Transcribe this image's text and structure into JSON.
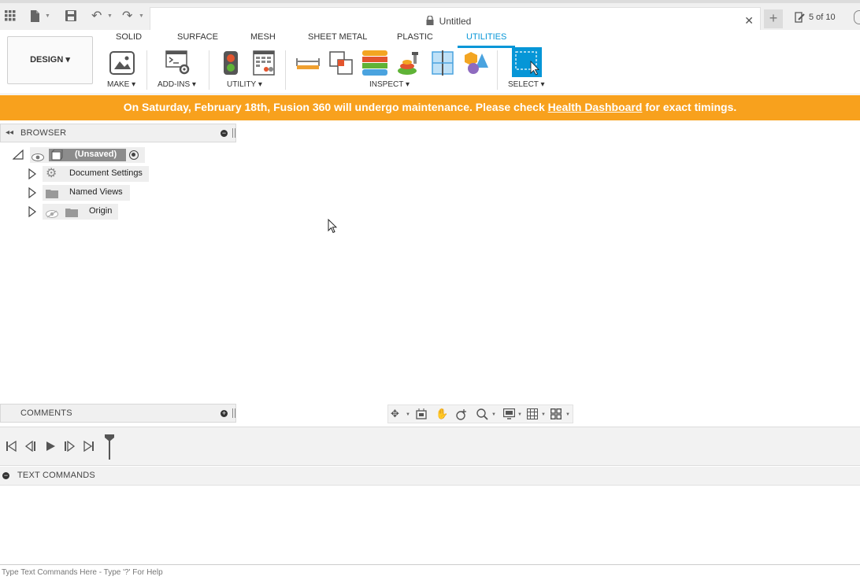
{
  "quick_access": {
    "icons": [
      "apps-grid-icon",
      "file-icon",
      "save-icon",
      "undo-icon",
      "redo-icon"
    ]
  },
  "document_tab": {
    "title": "Untitled",
    "close_symbol": "✕",
    "new_tab_symbol": "+"
  },
  "job_status": {
    "label": "5 of 10"
  },
  "workspace": {
    "label": "DESIGN ▾"
  },
  "ribbon": {
    "tabs": [
      {
        "label": "SOLID",
        "active": false
      },
      {
        "label": "SURFACE",
        "active": false
      },
      {
        "label": "MESH",
        "active": false
      },
      {
        "label": "SHEET METAL",
        "active": false
      },
      {
        "label": "PLASTIC",
        "active": false
      },
      {
        "label": "UTILITIES",
        "active": true
      }
    ],
    "groups": [
      {
        "label": "MAKE ▾"
      },
      {
        "label": "ADD-INS ▾"
      },
      {
        "label": "UTILITY ▾"
      },
      {
        "label": "INSPECT ▾"
      },
      {
        "label": "SELECT ▾"
      }
    ]
  },
  "banner": {
    "text_before": "On Saturday, February 18th, Fusion 360 will undergo maintenance. Please check ",
    "link_text": "Health Dashboard",
    "text_after": " for exact timings.",
    "color": "#f8a11d"
  },
  "browser": {
    "title": "BROWSER",
    "root": {
      "label": "(Unsaved)"
    },
    "items": [
      {
        "label": "Document Settings",
        "icon": "gear-icon"
      },
      {
        "label": "Named Views",
        "icon": "folder-icon"
      },
      {
        "label": "Origin",
        "icon": "folder-icon"
      }
    ]
  },
  "comments": {
    "title": "COMMENTS"
  },
  "text_commands": {
    "title": "TEXT COMMANDS",
    "placeholder": "Type Text Commands Here - Type '?' For Help"
  },
  "colors": {
    "accent": "#0696d7",
    "banner": "#f8a11d"
  }
}
